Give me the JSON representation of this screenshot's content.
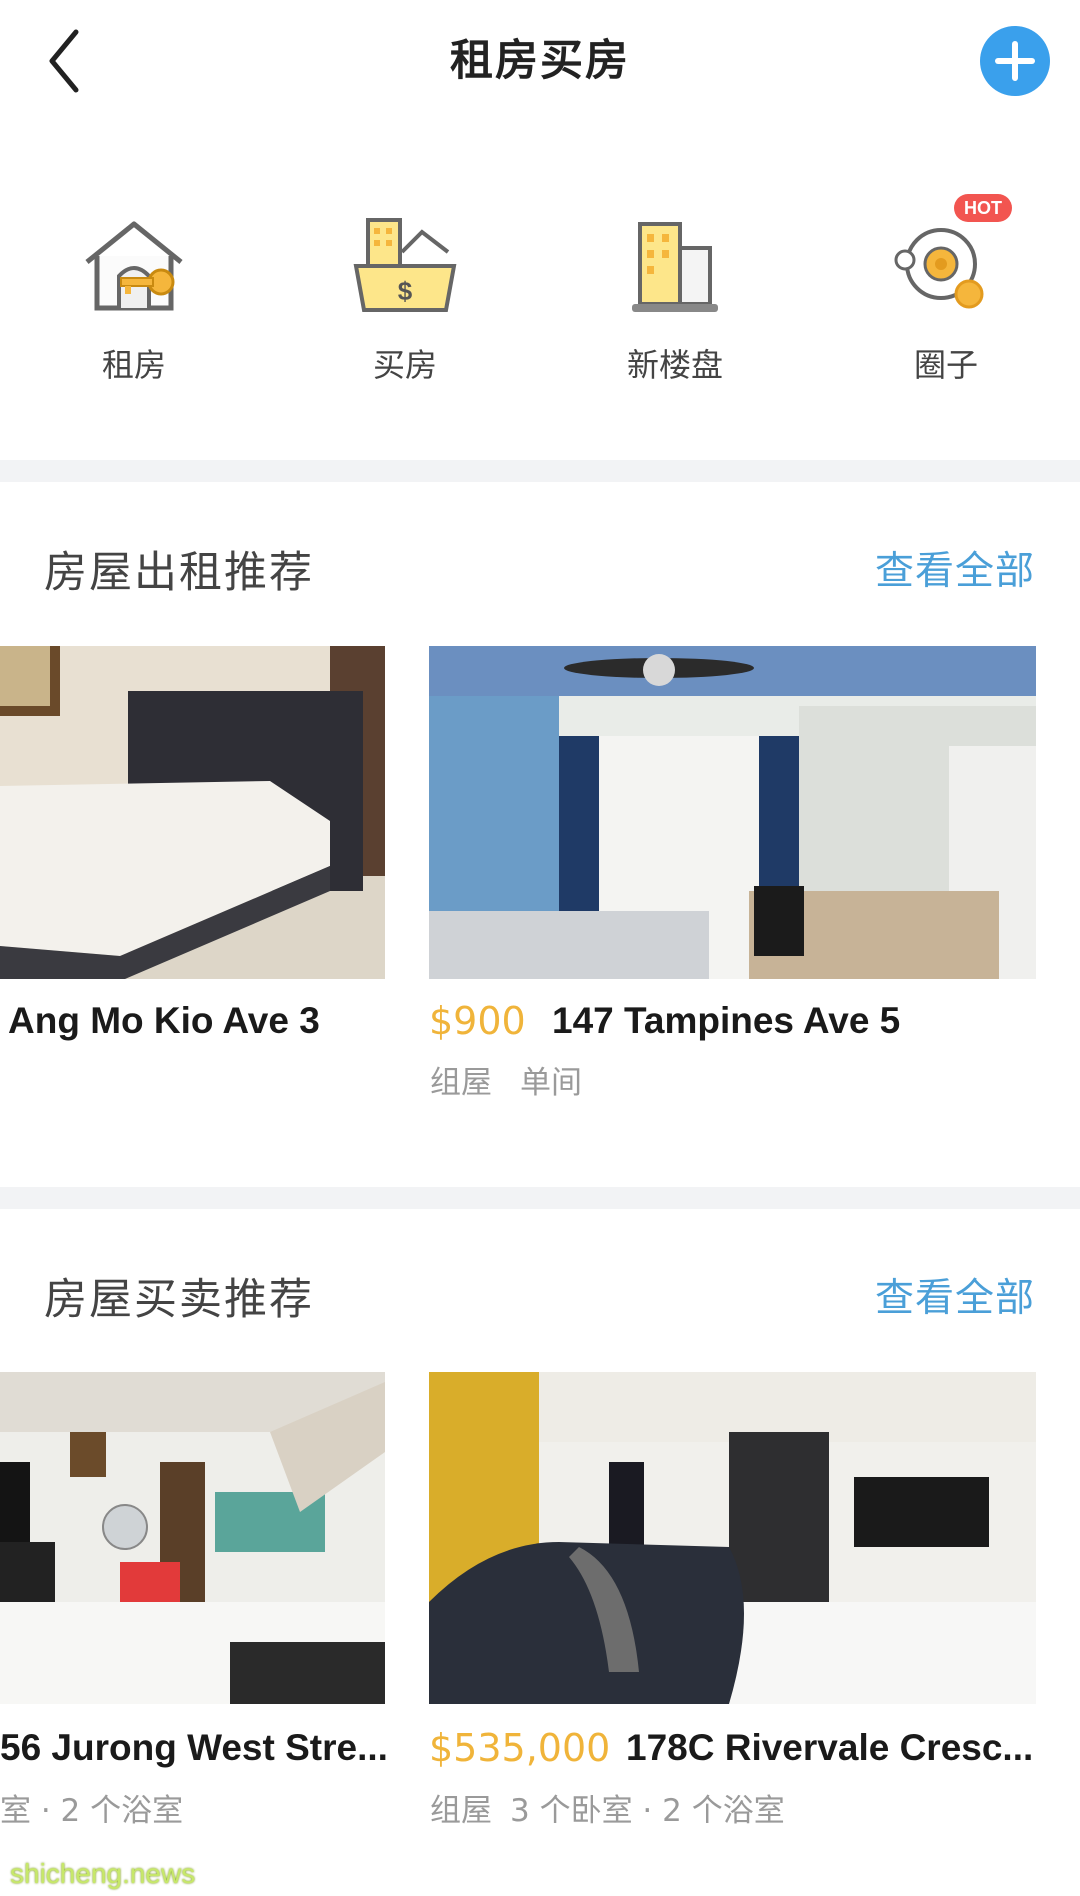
{
  "header": {
    "title": "租房买房"
  },
  "categories": [
    {
      "label": "租房",
      "icon": "house-key-icon"
    },
    {
      "label": "买房",
      "icon": "buy-house-icon"
    },
    {
      "label": "新楼盘",
      "icon": "new-building-icon"
    },
    {
      "label": "圈子",
      "icon": "community-icon",
      "badge": "HOT"
    }
  ],
  "rent": {
    "title": "房屋出租推荐",
    "see_all": "查看全部",
    "cards": [
      {
        "address": "Ang Mo Kio Ave 3"
      },
      {
        "price": "$900",
        "address": "147 Tampines Ave 5",
        "type": "组屋",
        "room": "单间"
      }
    ]
  },
  "sale": {
    "title": "房屋买卖推荐",
    "see_all": "查看全部",
    "cards": [
      {
        "address": "56 Jurong West Stre...",
        "meta": "室 · 2 个浴室"
      },
      {
        "price": "$535,000",
        "address": "178C Rivervale Cresc...",
        "type": "组屋",
        "meta": "3 个卧室 · 2 个浴室"
      }
    ]
  },
  "watermark": "shicheng.news",
  "colors": {
    "accent": "#3aa0ec",
    "price": "#f0b43a",
    "link": "#4a9fd8"
  }
}
